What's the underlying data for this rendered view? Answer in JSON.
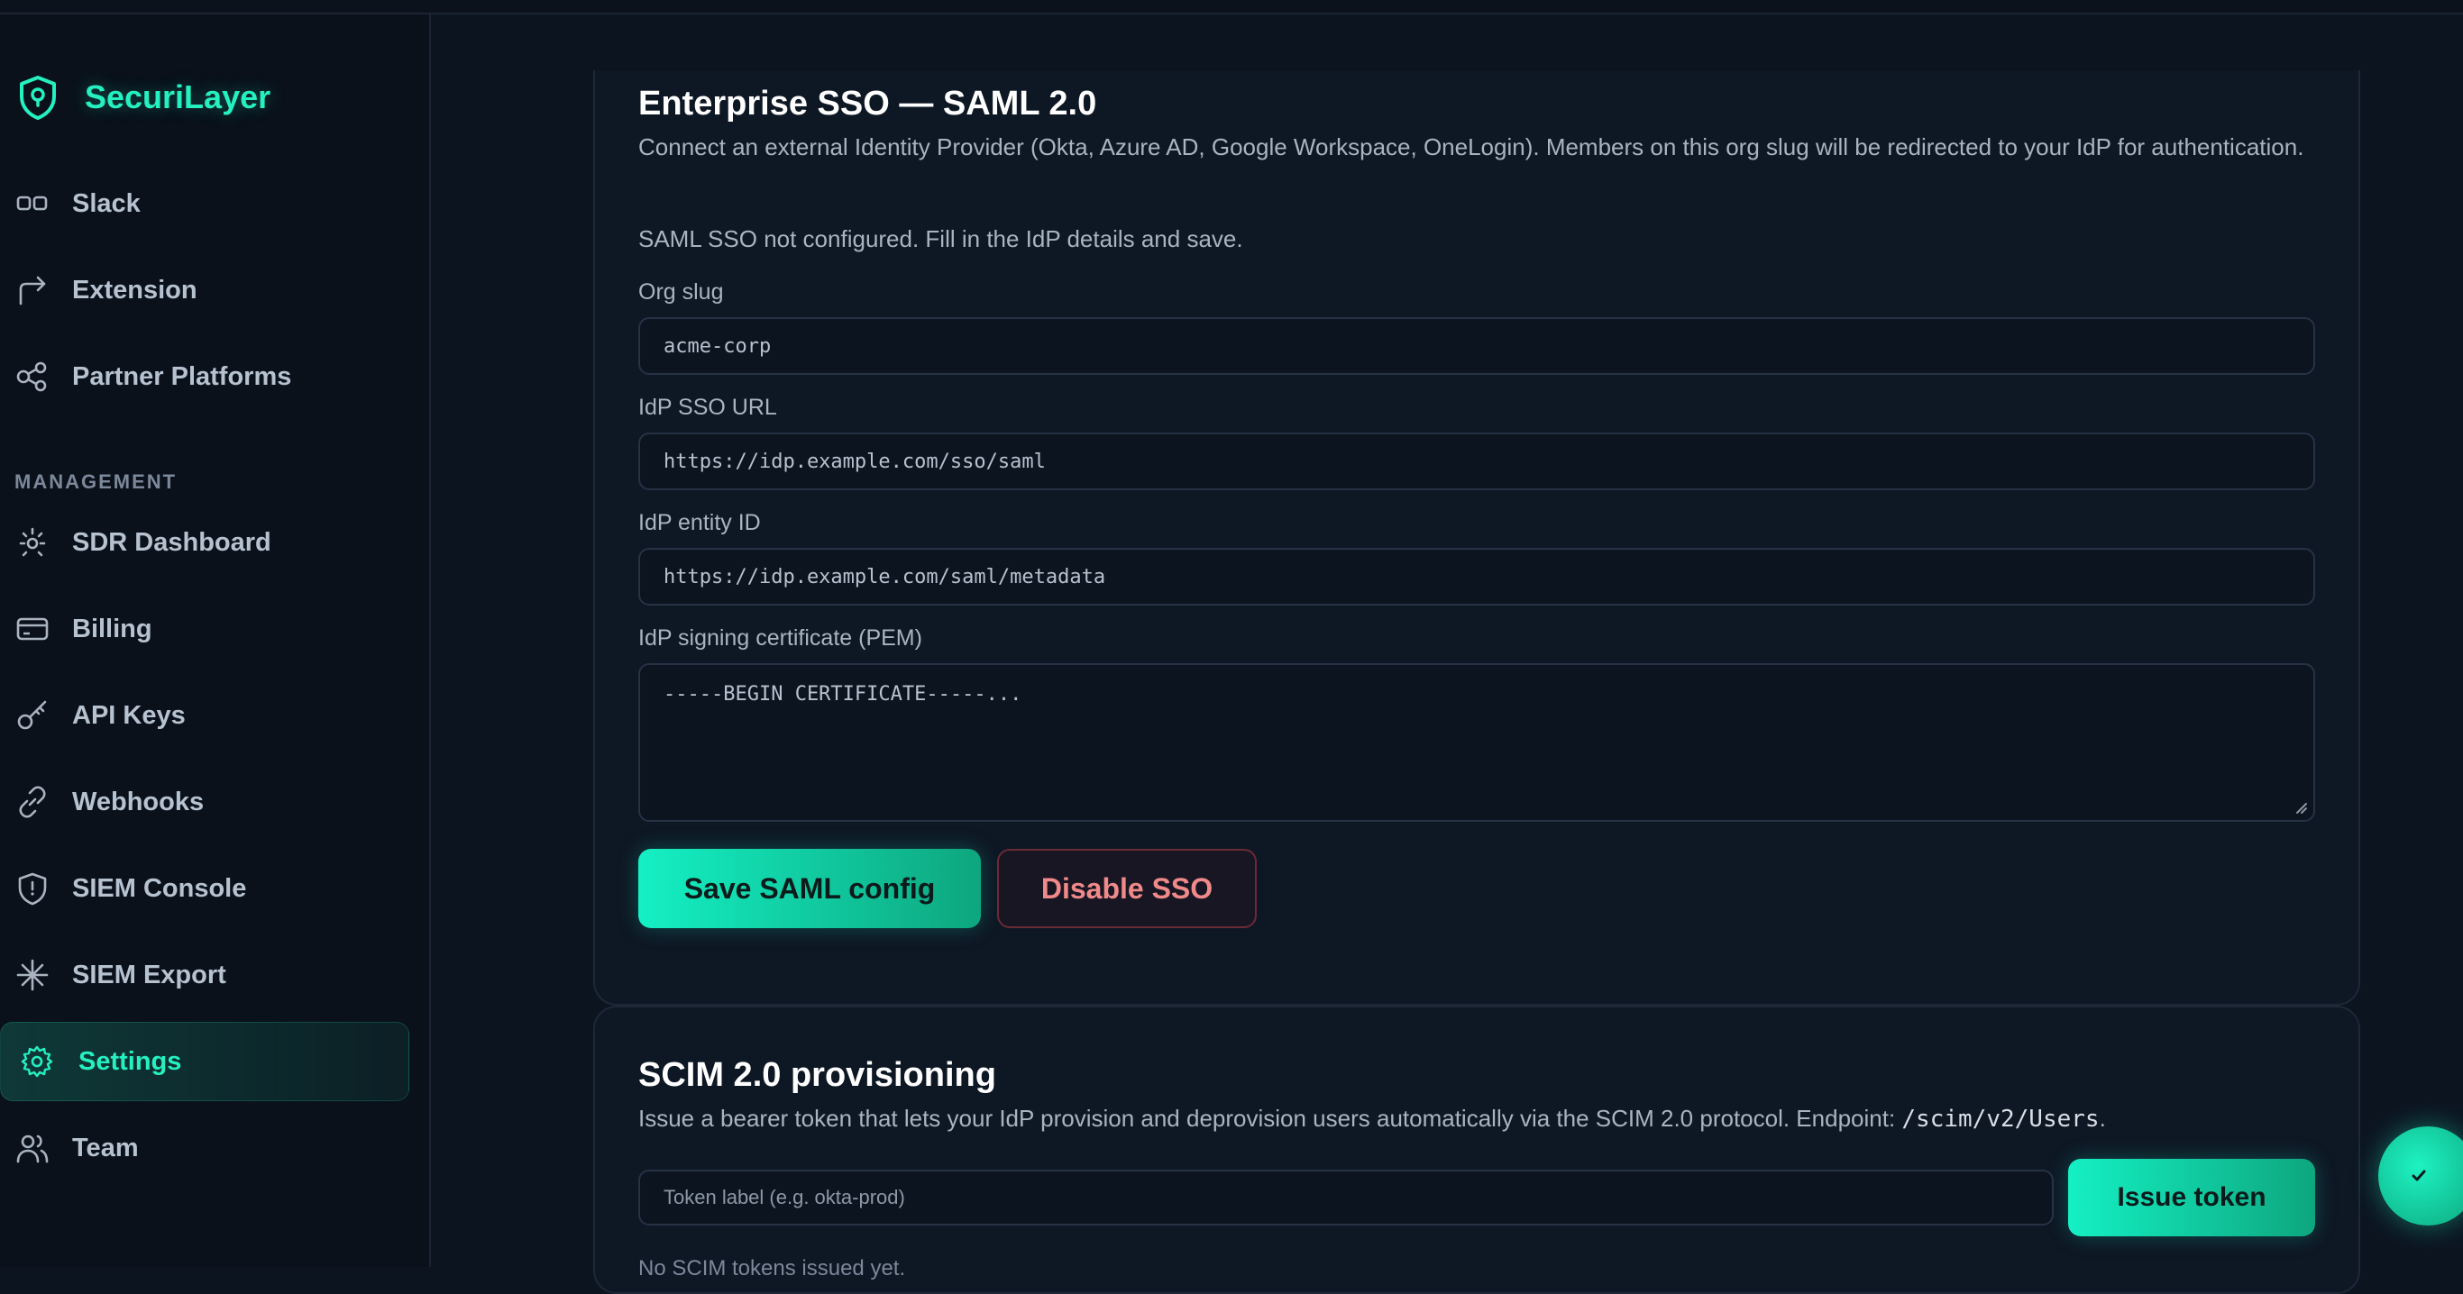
{
  "brand": {
    "name": "SecuriLayer"
  },
  "sidebar": {
    "items_top": [
      {
        "label": "Slack",
        "icon": "slack-icon"
      },
      {
        "label": "Extension",
        "icon": "share-arrow-icon"
      },
      {
        "label": "Partner Platforms",
        "icon": "nodes-icon"
      }
    ],
    "section_label": "MANAGEMENT",
    "items_mgmt": [
      {
        "label": "SDR Dashboard",
        "icon": "sun-spark-icon"
      },
      {
        "label": "Billing",
        "icon": "credit-card-icon"
      },
      {
        "label": "API Keys",
        "icon": "key-icon"
      },
      {
        "label": "Webhooks",
        "icon": "link-icon"
      },
      {
        "label": "SIEM Console",
        "icon": "shield-icon"
      },
      {
        "label": "SIEM Export",
        "icon": "asterisk-icon"
      },
      {
        "label": "Settings",
        "icon": "gear-icon",
        "active": true
      },
      {
        "label": "Team",
        "icon": "users-icon"
      }
    ]
  },
  "sso": {
    "title": "Enterprise SSO — SAML 2.0",
    "description": "Connect an external Identity Provider (Okta, Azure AD, Google Workspace, OneLogin). Members on this org slug will be redirected to your IdP for authentication.",
    "status": "SAML SSO not configured. Fill in the IdP details and save.",
    "fields": {
      "org_slug": {
        "label": "Org slug",
        "placeholder": "acme-corp"
      },
      "sso_url": {
        "label": "IdP SSO URL",
        "placeholder": "https://idp.example.com/sso/saml"
      },
      "entity_id": {
        "label": "IdP entity ID",
        "placeholder": "https://idp.example.com/saml/metadata"
      },
      "certificate": {
        "label": "IdP signing certificate (PEM)",
        "placeholder": "-----BEGIN CERTIFICATE-----..."
      }
    },
    "save_label": "Save SAML config",
    "disable_label": "Disable SSO"
  },
  "scim": {
    "title": "SCIM 2.0 provisioning",
    "description_before": "Issue a bearer token that lets your IdP provision and deprovision users automatically via the SCIM 2.0 protocol. Endpoint: ",
    "endpoint": "/scim/v2/Users",
    "description_after": ".",
    "token_placeholder": "Token label (e.g. okta-prod)",
    "issue_label": "Issue token",
    "status_text": "No SCIM tokens issued yet."
  },
  "colors": {
    "accent": "#25f0c0",
    "danger": "#f08a8a",
    "background": "#0c1420"
  }
}
